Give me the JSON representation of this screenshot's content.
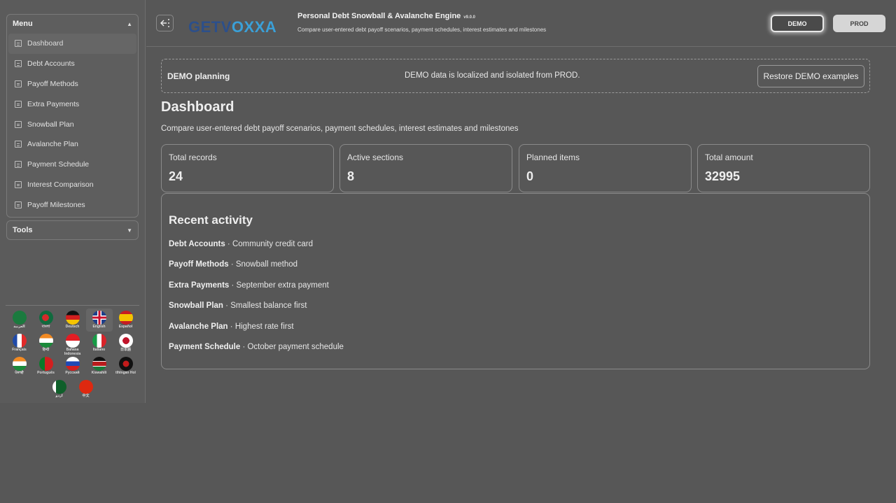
{
  "sidebar": {
    "menu_title": "Menu",
    "menu_items": [
      {
        "label": "Dashboard",
        "active": true
      },
      {
        "label": "Debt Accounts"
      },
      {
        "label": "Payoff Methods"
      },
      {
        "label": "Extra Payments"
      },
      {
        "label": "Snowball Plan"
      },
      {
        "label": "Avalanche Plan"
      },
      {
        "label": "Payment Schedule"
      },
      {
        "label": "Interest Comparison"
      },
      {
        "label": "Payoff Milestones"
      }
    ],
    "tools_title": "Tools",
    "languages": [
      {
        "label": "العربية",
        "flag": "sa"
      },
      {
        "label": "বাংলা",
        "flag": "bd"
      },
      {
        "label": "Deutsch",
        "flag": "de"
      },
      {
        "label": "English",
        "flag": "gb",
        "selected": true
      },
      {
        "label": "Español",
        "flag": "es"
      },
      {
        "label": "Français",
        "flag": "fr"
      },
      {
        "label": "हिन्दी",
        "flag": "in"
      },
      {
        "label": "Bahasa Indonesia",
        "flag": "id"
      },
      {
        "label": "Italiano",
        "flag": "it"
      },
      {
        "label": "日本語",
        "flag": "jp"
      },
      {
        "label": "ਪੰਜਾਬੀ",
        "flag": "in"
      },
      {
        "label": "Português",
        "flag": "pt"
      },
      {
        "label": "Русский",
        "flag": "ru"
      },
      {
        "label": "Kiswahili",
        "flag": "ke"
      },
      {
        "label": "tlhIngan Hol",
        "flag": "kl"
      },
      {
        "label": "اردو",
        "flag": "pk"
      },
      {
        "label": "中文",
        "flag": "cn"
      }
    ]
  },
  "header": {
    "logo_get": "GET",
    "logo_v": "V",
    "logo_rest": "OXXA",
    "title": "Personal Debt Snowball & Avalanche Engine",
    "version": "v9.0.0",
    "subtitle": "Compare user-entered debt payoff scenarios, payment schedules, interest estimates and milestones",
    "demo_label": "DEMO",
    "prod_label": "PROD"
  },
  "notice": {
    "title": "DEMO planning",
    "message": "DEMO data is localized and isolated from PROD.",
    "restore_label": "Restore DEMO examples"
  },
  "page": {
    "title": "Dashboard",
    "subtitle": "Compare user-entered debt payoff scenarios, payment schedules, interest estimates and milestones"
  },
  "stats": [
    {
      "label": "Total records",
      "value": "24"
    },
    {
      "label": "Active sections",
      "value": "8"
    },
    {
      "label": "Planned items",
      "value": "0"
    },
    {
      "label": "Total amount",
      "value": "32995"
    }
  ],
  "activity": {
    "title": "Recent activity",
    "items": [
      {
        "section": "Debt Accounts",
        "detail": " · Community credit card"
      },
      {
        "section": "Payoff Methods",
        "detail": " · Snowball method"
      },
      {
        "section": "Extra Payments",
        "detail": " · September extra payment"
      },
      {
        "section": "Snowball Plan",
        "detail": " · Smallest balance first"
      },
      {
        "section": "Avalanche Plan",
        "detail": " · Highest rate first"
      },
      {
        "section": "Payment Schedule",
        "detail": " · October payment schedule"
      }
    ]
  },
  "colors": {
    "background": "#575757",
    "logo_dark": "#2c4f8a",
    "logo_light": "#3aa0d8"
  }
}
